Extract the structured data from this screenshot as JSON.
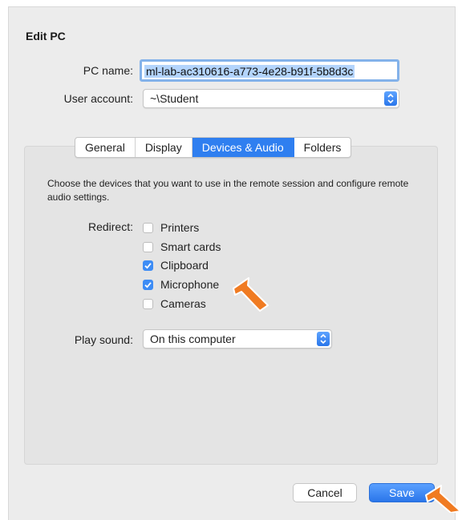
{
  "dialog": {
    "title": "Edit PC",
    "pc_name_label": "PC name:",
    "pc_name_value": "ml-lab-ac310616-a773-4e28-b91f-5b8d3c",
    "user_account_label": "User account:",
    "user_account_value": "~\\Student"
  },
  "tabs": [
    {
      "label": "General",
      "active": false
    },
    {
      "label": "Display",
      "active": false
    },
    {
      "label": "Devices & Audio",
      "active": true
    },
    {
      "label": "Folders",
      "active": false
    }
  ],
  "devices": {
    "description": "Choose the devices that you want to use in the remote session and configure remote audio settings.",
    "redirect_label": "Redirect:",
    "options": [
      {
        "label": "Printers",
        "checked": false
      },
      {
        "label": "Smart cards",
        "checked": false
      },
      {
        "label": "Clipboard",
        "checked": true
      },
      {
        "label": "Microphone",
        "checked": true
      },
      {
        "label": "Cameras",
        "checked": false
      }
    ],
    "play_sound_label": "Play sound:",
    "play_sound_value": "On this computer"
  },
  "buttons": {
    "cancel": "Cancel",
    "save": "Save"
  },
  "colors": {
    "accent": "#2f7ff0",
    "pointer": "#f07b22"
  },
  "icons": [
    "popup-stepper-icon",
    "checkmark-icon",
    "arrow-pointer-icon"
  ]
}
